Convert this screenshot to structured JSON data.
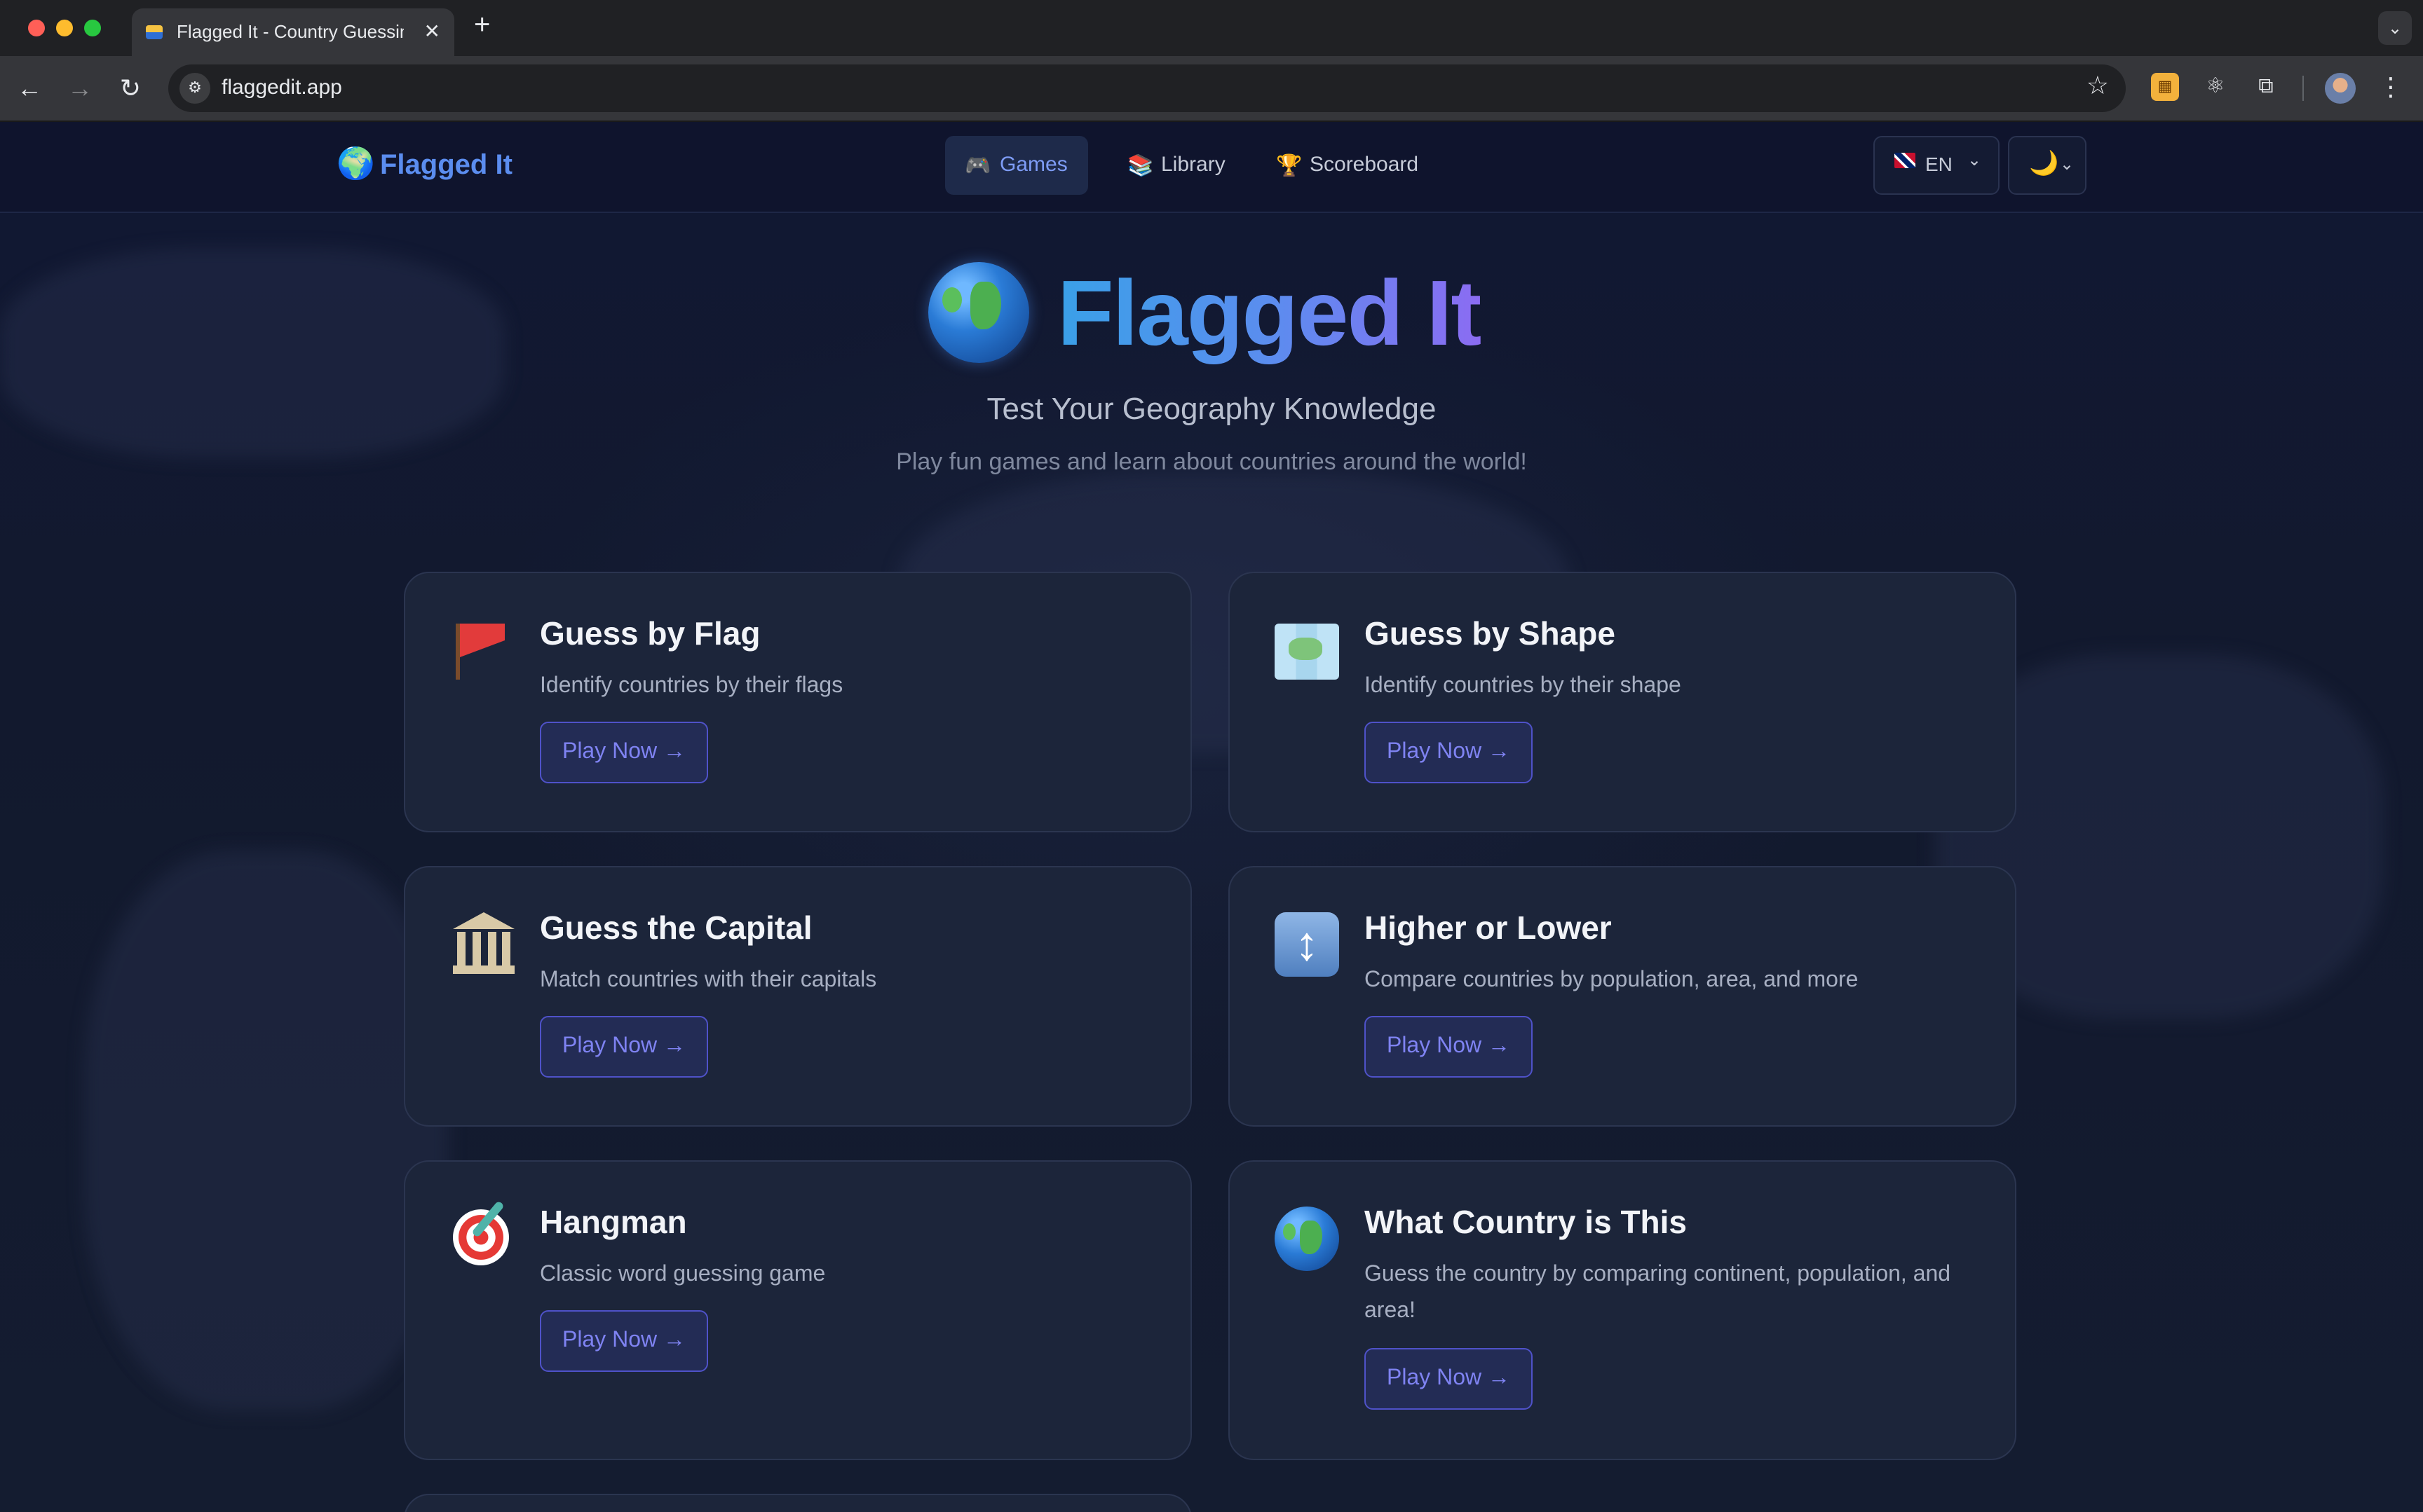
{
  "browser": {
    "tab_title": "Flagged It - Country Guessing",
    "tab_close": "✕",
    "new_tab": "+",
    "tab_menu": "⌄",
    "url": "flaggedit.app",
    "icons": [
      "back-icon",
      "forward-icon",
      "reload-icon",
      "site-info-icon",
      "star-icon",
      "extension-icon",
      "react-devtools-icon",
      "puzzle-icon",
      "profile-avatar",
      "more-icon"
    ]
  },
  "header": {
    "brand": "Flagged It",
    "nav": [
      {
        "label": "Games",
        "icon": "🎮"
      },
      {
        "label": "Library",
        "icon": "📚"
      },
      {
        "label": "Scoreboard",
        "icon": "🏆"
      }
    ],
    "language": "EN",
    "theme_icon": "🌙",
    "accent": "#5b8def"
  },
  "hero": {
    "title": "Flagged It",
    "subtitle": "Test Your Geography Knowledge",
    "description": "Play fun games and learn about countries around the world!"
  },
  "games": [
    {
      "title": "Guess by Flag",
      "description": "Identify countries by their flags",
      "button": "Play Now →",
      "icon": "flag-icon"
    },
    {
      "title": "Guess by Shape",
      "description": "Identify countries by their shape",
      "button": "Play Now →",
      "icon": "map-icon"
    },
    {
      "title": "Guess the Capital",
      "description": "Match countries with their capitals",
      "button": "Play Now →",
      "icon": "classical-building-icon"
    },
    {
      "title": "Higher or Lower",
      "description": "Compare countries by population, area, and more",
      "button": "Play Now →",
      "icon": "up-down-arrow-icon"
    },
    {
      "title": "Hangman",
      "description": "Classic word guessing game",
      "button": "Play Now →",
      "icon": "dart-target-icon"
    },
    {
      "title": "What Country is This",
      "description": "Guess the country by comparing continent, population, and area!",
      "button": "Play Now →",
      "icon": "globe-icon"
    }
  ]
}
